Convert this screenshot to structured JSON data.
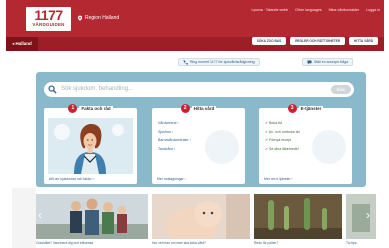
{
  "header": {
    "logo_number": "1177",
    "logo_subtitle": "VÅRDGUIDEN",
    "region": "Region Halland",
    "top_links": [
      "Lyssna · Talande webb",
      "Other languages",
      "Mina vårdkontakter",
      "Logga in"
    ],
    "buttons": [
      "SÖKA ZOO BAS",
      "REGLER OCH RÄTTIGHETER",
      "HITTA VÅRD"
    ]
  },
  "nav": {
    "home": "Halland"
  },
  "utility": {
    "phone": "Ring numret 1177 för sjukvårdsrådgivning",
    "anonymous": "Ställ en anonym fråga"
  },
  "search": {
    "placeholder": "Sök sjukdom, behandling...",
    "button": "SÖK"
  },
  "cards": [
    {
      "badge": "1",
      "title": "Fakta och råd",
      "footer": "Allt om sjukdomar och fakta i"
    },
    {
      "badge": "2",
      "title": "Hitta vård",
      "items": [
        "Vårdcentral",
        "Sjukhus",
        "Barnavårdcentraler",
        "Tandvård"
      ],
      "footer": "Mer mottagningar"
    },
    {
      "badge": "3",
      "title": "E-tjänster",
      "items": [
        "Boka tid",
        "Av- och omboka tid",
        "Förnya recept",
        "Se dina läkemedel"
      ],
      "footer": "Mer om e-tjänster"
    }
  ],
  "promos": [
    "Graviditet? Vaccinera dig mot influensa",
    "Hur vet man om man ska söka vård?",
    "Redo för pollen?",
    "Tio tips"
  ],
  "colors": {
    "brand_red": "#b42832",
    "panel_blue": "#89b9ca",
    "link_blue": "#2f5f8a"
  }
}
